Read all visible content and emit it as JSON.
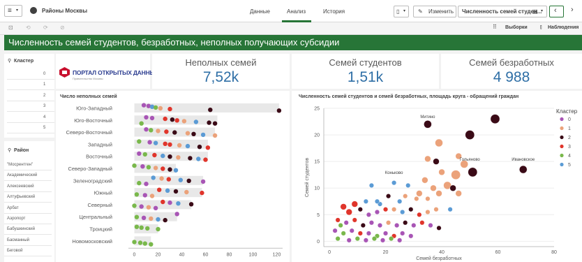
{
  "header": {
    "app_title": "Районы Москвы",
    "tabs": [
      "Данные",
      "Анализ",
      "История"
    ],
    "active_tab": 1,
    "edit_label": "Изменить",
    "sheet_title": "Численность семей студен...",
    "selections_label": "Выборки",
    "observations_label": "Наблюдения"
  },
  "banner": {
    "text": "Численность семей студентов, безработных, неполных получающих субсидии"
  },
  "filters": {
    "cluster": {
      "title": "Кластер",
      "items": [
        "0",
        "1",
        "2",
        "3",
        "4",
        "5"
      ]
    },
    "district": {
      "title": "Район",
      "items": [
        "\"Мосрентген\"",
        "Академический",
        "Алексеевский",
        "Алтуфьевский",
        "Арбат",
        "Аэропорт",
        "Бабушкинский",
        "Басманный",
        "Беговой"
      ]
    }
  },
  "logo": {
    "title": "ПОРТАЛ ОТКРЫТЫХ ДАННЫХ",
    "subtitle": "Правительство Москвы"
  },
  "kpis": [
    {
      "title": "Неполных семей",
      "value": "7,52k"
    },
    {
      "title": "Семей студентов",
      "value": "1,51k"
    },
    {
      "title": "Семей безработных",
      "value": "4 988"
    }
  ],
  "colors": {
    "accent_green": "#277537",
    "kpi_blue": "#2f6fa6",
    "cluster_0": "#a855b5",
    "cluster_1": "#eba27a",
    "cluster_2": "#3a0a16",
    "cluster_3": "#e0352b",
    "cluster_4": "#79b84b",
    "cluster_5": "#5b9bd5"
  },
  "chart_data": [
    {
      "type": "scatter",
      "title": "Число неполных семей",
      "categories": [
        "Юго-Западный",
        "Юго-Восточный",
        "Северо-Восточный",
        "Западный",
        "Восточный",
        "Северо-Западный",
        "Зеленоградский",
        "Южный",
        "Северный",
        "Центральный",
        "Троицкий",
        "Новомосковский"
      ],
      "range_max": [
        122,
        70,
        68,
        62,
        62,
        35,
        58,
        57,
        48,
        36,
        20,
        14
      ],
      "xlim": [
        -5,
        125
      ],
      "xticks": [
        0,
        20,
        40,
        60,
        80,
        100,
        120
      ],
      "points": [
        {
          "c": 0,
          "x": 8,
          "k": 0
        },
        {
          "c": 0,
          "x": 12,
          "k": 0
        },
        {
          "c": 5,
          "x": 15,
          "k": 0
        },
        {
          "c": 4,
          "x": 18,
          "k": 0
        },
        {
          "c": 1,
          "x": 22,
          "k": 0
        },
        {
          "c": 3,
          "x": 30,
          "k": 0
        },
        {
          "c": 2,
          "x": 64,
          "k": 0
        },
        {
          "c": 2,
          "x": 122,
          "k": 0
        },
        {
          "c": 4,
          "x": 6,
          "k": 1
        },
        {
          "c": 0,
          "x": 10,
          "k": 1
        },
        {
          "c": 0,
          "x": 15,
          "k": 1
        },
        {
          "c": 3,
          "x": 26,
          "k": 1
        },
        {
          "c": 2,
          "x": 32,
          "k": 1
        },
        {
          "c": 3,
          "x": 36,
          "k": 1
        },
        {
          "c": 1,
          "x": 42,
          "k": 1
        },
        {
          "c": 5,
          "x": 52,
          "k": 1
        },
        {
          "c": 2,
          "x": 63,
          "k": 1
        },
        {
          "c": 2,
          "x": 68,
          "k": 1
        },
        {
          "c": 0,
          "x": 10,
          "k": 2
        },
        {
          "c": 4,
          "x": 14,
          "k": 2
        },
        {
          "c": 1,
          "x": 20,
          "k": 2
        },
        {
          "c": 3,
          "x": 27,
          "k": 2
        },
        {
          "c": 2,
          "x": 34,
          "k": 2
        },
        {
          "c": 1,
          "x": 45,
          "k": 2
        },
        {
          "c": 2,
          "x": 50,
          "k": 2
        },
        {
          "c": 5,
          "x": 58,
          "k": 2
        },
        {
          "c": 1,
          "x": 68,
          "k": 2
        },
        {
          "c": 4,
          "x": 4,
          "k": 3
        },
        {
          "c": 0,
          "x": 13,
          "k": 3
        },
        {
          "c": 5,
          "x": 18,
          "k": 3
        },
        {
          "c": 3,
          "x": 26,
          "k": 3
        },
        {
          "c": 3,
          "x": 30,
          "k": 3
        },
        {
          "c": 1,
          "x": 38,
          "k": 3
        },
        {
          "c": 5,
          "x": 45,
          "k": 3
        },
        {
          "c": 2,
          "x": 55,
          "k": 3
        },
        {
          "c": 3,
          "x": 62,
          "k": 3
        },
        {
          "c": 0,
          "x": 4,
          "k": 4
        },
        {
          "c": 4,
          "x": 9,
          "k": 4
        },
        {
          "c": 3,
          "x": 17,
          "k": 4
        },
        {
          "c": 5,
          "x": 24,
          "k": 4
        },
        {
          "c": 2,
          "x": 30,
          "k": 4
        },
        {
          "c": 1,
          "x": 37,
          "k": 4
        },
        {
          "c": 2,
          "x": 47,
          "k": 4
        },
        {
          "c": 5,
          "x": 54,
          "k": 4
        },
        {
          "c": 3,
          "x": 60,
          "k": 4
        },
        {
          "c": 4,
          "x": 0,
          "k": 5
        },
        {
          "c": 0,
          "x": 7,
          "k": 5
        },
        {
          "c": 4,
          "x": 12,
          "k": 5
        },
        {
          "c": 1,
          "x": 18,
          "k": 5
        },
        {
          "c": 3,
          "x": 24,
          "k": 5
        },
        {
          "c": 2,
          "x": 30,
          "k": 5
        },
        {
          "c": 5,
          "x": 35,
          "k": 5
        },
        {
          "c": 4,
          "x": 4,
          "k": 6
        },
        {
          "c": 0,
          "x": 10,
          "k": 6
        },
        {
          "c": 5,
          "x": 16,
          "k": 6
        },
        {
          "c": 1,
          "x": 23,
          "k": 6
        },
        {
          "c": 3,
          "x": 29,
          "k": 6
        },
        {
          "c": 5,
          "x": 39,
          "k": 6
        },
        {
          "c": 2,
          "x": 46,
          "k": 6
        },
        {
          "c": 0,
          "x": 58,
          "k": 6
        },
        {
          "c": 4,
          "x": 2,
          "k": 7
        },
        {
          "c": 0,
          "x": 9,
          "k": 7
        },
        {
          "c": 1,
          "x": 15,
          "k": 7
        },
        {
          "c": 3,
          "x": 21,
          "k": 7
        },
        {
          "c": 5,
          "x": 28,
          "k": 7
        },
        {
          "c": 2,
          "x": 35,
          "k": 7
        },
        {
          "c": 1,
          "x": 44,
          "k": 7
        },
        {
          "c": 3,
          "x": 57,
          "k": 7
        },
        {
          "c": 4,
          "x": 0,
          "k": 8
        },
        {
          "c": 0,
          "x": 6,
          "k": 8
        },
        {
          "c": 1,
          "x": 12,
          "k": 8
        },
        {
          "c": 0,
          "x": 18,
          "k": 8
        },
        {
          "c": 3,
          "x": 24,
          "k": 8
        },
        {
          "c": 0,
          "x": 30,
          "k": 8
        },
        {
          "c": 5,
          "x": 37,
          "k": 8
        },
        {
          "c": 2,
          "x": 48,
          "k": 8
        },
        {
          "c": 4,
          "x": 2,
          "k": 9
        },
        {
          "c": 0,
          "x": 8,
          "k": 9
        },
        {
          "c": 1,
          "x": 14,
          "k": 9
        },
        {
          "c": 5,
          "x": 20,
          "k": 9
        },
        {
          "c": 2,
          "x": 26,
          "k": 9
        },
        {
          "c": 0,
          "x": 36,
          "k": 9
        },
        {
          "c": 4,
          "x": 2,
          "k": 10
        },
        {
          "c": 4,
          "x": 6,
          "k": 10
        },
        {
          "c": 4,
          "x": 11,
          "k": 10
        },
        {
          "c": 4,
          "x": 20,
          "k": 10
        },
        {
          "c": 4,
          "x": 0,
          "k": 11
        },
        {
          "c": 4,
          "x": 5,
          "k": 11
        },
        {
          "c": 4,
          "x": 9,
          "k": 11
        },
        {
          "c": 4,
          "x": 14,
          "k": 11
        }
      ]
    },
    {
      "type": "scatter",
      "title": "Численность семей студентов и семей безработных, площадь круга - обращений граждан",
      "xlabel": "Семей безработных",
      "ylabel": "Семей студентов",
      "xlim": [
        -2,
        80
      ],
      "ylim": [
        -1,
        25
      ],
      "xticks": [
        0,
        20,
        40,
        60,
        80
      ],
      "yticks": [
        0,
        5,
        10,
        15,
        20,
        25
      ],
      "legend_title": "Кластер",
      "legend": [
        "0",
        "1",
        "2",
        "3",
        "4",
        "5"
      ],
      "annotations": [
        {
          "text": "Митино",
          "x": 35,
          "y": 22
        },
        {
          "text": "Гольяново",
          "x": 50,
          "y": 14
        },
        {
          "text": "Ивановское",
          "x": 69,
          "y": 14
        },
        {
          "text": "Коньково",
          "x": 23,
          "y": 11.5
        }
      ],
      "points": [
        {
          "x": 35,
          "y": 22,
          "c": 2,
          "s": 5
        },
        {
          "x": 59,
          "y": 23,
          "c": 2,
          "s": 6
        },
        {
          "x": 50,
          "y": 20,
          "c": 2,
          "s": 6
        },
        {
          "x": 39,
          "y": 18.5,
          "c": 1,
          "s": 5
        },
        {
          "x": 51,
          "y": 13,
          "c": 2,
          "s": 6
        },
        {
          "x": 69,
          "y": 13.5,
          "c": 2,
          "s": 5
        },
        {
          "x": 45,
          "y": 12.5,
          "c": 1,
          "s": 6
        },
        {
          "x": 48,
          "y": 14.5,
          "c": 1,
          "s": 5
        },
        {
          "x": 35,
          "y": 15.5,
          "c": 1,
          "s": 4
        },
        {
          "x": 38,
          "y": 15,
          "c": 2,
          "s": 4
        },
        {
          "x": 46,
          "y": 16,
          "c": 1,
          "s": 4
        },
        {
          "x": 40,
          "y": 13,
          "c": 1,
          "s": 4
        },
        {
          "x": 34,
          "y": 11.5,
          "c": 1,
          "s": 4
        },
        {
          "x": 42,
          "y": 10.5,
          "c": 1,
          "s": 5
        },
        {
          "x": 37,
          "y": 10,
          "c": 1,
          "s": 4
        },
        {
          "x": 44,
          "y": 10,
          "c": 2,
          "s": 4
        },
        {
          "x": 32,
          "y": 9,
          "c": 1,
          "s": 4
        },
        {
          "x": 39,
          "y": 9,
          "c": 1,
          "s": 4
        },
        {
          "x": 46,
          "y": 9,
          "c": 1,
          "s": 4
        },
        {
          "x": 28,
          "y": 10.5,
          "c": 5,
          "s": 3
        },
        {
          "x": 15,
          "y": 10.5,
          "c": 5,
          "s": 3
        },
        {
          "x": 23,
          "y": 11,
          "c": 5,
          "s": 3
        },
        {
          "x": 27,
          "y": 8.5,
          "c": 1,
          "s": 3
        },
        {
          "x": 31,
          "y": 8,
          "c": 1,
          "s": 3
        },
        {
          "x": 35,
          "y": 8,
          "c": 1,
          "s": 3
        },
        {
          "x": 25,
          "y": 7.5,
          "c": 5,
          "s": 3
        },
        {
          "x": 21,
          "y": 8.5,
          "c": 2,
          "s": 3
        },
        {
          "x": 18,
          "y": 7,
          "c": 5,
          "s": 3
        },
        {
          "x": 13,
          "y": 7.5,
          "c": 5,
          "s": 3
        },
        {
          "x": 9,
          "y": 7,
          "c": 3,
          "s": 4
        },
        {
          "x": 5,
          "y": 6.5,
          "c": 3,
          "s": 4
        },
        {
          "x": 7,
          "y": 5.5,
          "c": 3,
          "s": 4
        },
        {
          "x": 11,
          "y": 6,
          "c": 2,
          "s": 3
        },
        {
          "x": 14,
          "y": 5,
          "c": 0,
          "s": 3
        },
        {
          "x": 17,
          "y": 5.5,
          "c": 0,
          "s": 3
        },
        {
          "x": 20,
          "y": 6,
          "c": 3,
          "s": 3
        },
        {
          "x": 23,
          "y": 6,
          "c": 1,
          "s": 3
        },
        {
          "x": 26,
          "y": 5.5,
          "c": 5,
          "s": 3
        },
        {
          "x": 29,
          "y": 6,
          "c": 2,
          "s": 3
        },
        {
          "x": 32,
          "y": 5,
          "c": 3,
          "s": 3
        },
        {
          "x": 35,
          "y": 5.5,
          "c": 1,
          "s": 3
        },
        {
          "x": 38,
          "y": 6,
          "c": 1,
          "s": 3
        },
        {
          "x": 43,
          "y": 6,
          "c": 5,
          "s": 3
        },
        {
          "x": 3,
          "y": 4,
          "c": 3,
          "s": 3
        },
        {
          "x": 6,
          "y": 3.5,
          "c": 0,
          "s": 3
        },
        {
          "x": 9,
          "y": 4,
          "c": 3,
          "s": 3
        },
        {
          "x": 12,
          "y": 3,
          "c": 2,
          "s": 3
        },
        {
          "x": 15,
          "y": 3.5,
          "c": 0,
          "s": 3
        },
        {
          "x": 18,
          "y": 3,
          "c": 0,
          "s": 3
        },
        {
          "x": 21,
          "y": 3.5,
          "c": 1,
          "s": 3
        },
        {
          "x": 24,
          "y": 3,
          "c": 0,
          "s": 3
        },
        {
          "x": 27,
          "y": 3.5,
          "c": 2,
          "s": 3
        },
        {
          "x": 30,
          "y": 3,
          "c": 0,
          "s": 3
        },
        {
          "x": 33,
          "y": 3.5,
          "c": 3,
          "s": 3
        },
        {
          "x": 36,
          "y": 3,
          "c": 0,
          "s": 3
        },
        {
          "x": 39,
          "y": 2.5,
          "c": 2,
          "s": 3
        },
        {
          "x": 2,
          "y": 2,
          "c": 0,
          "s": 3
        },
        {
          "x": 5,
          "y": 1.5,
          "c": 4,
          "s": 3
        },
        {
          "x": 8,
          "y": 2,
          "c": 0,
          "s": 3
        },
        {
          "x": 11,
          "y": 1.5,
          "c": 3,
          "s": 3
        },
        {
          "x": 14,
          "y": 1.5,
          "c": 0,
          "s": 3
        },
        {
          "x": 17,
          "y": 1,
          "c": 4,
          "s": 3
        },
        {
          "x": 20,
          "y": 1.5,
          "c": 0,
          "s": 3
        },
        {
          "x": 23,
          "y": 1,
          "c": 3,
          "s": 3
        },
        {
          "x": 26,
          "y": 1.5,
          "c": 0,
          "s": 3
        },
        {
          "x": 29,
          "y": 1,
          "c": 0,
          "s": 3
        },
        {
          "x": 3,
          "y": 0.5,
          "c": 4,
          "s": 3
        },
        {
          "x": 7,
          "y": 0.2,
          "c": 0,
          "s": 3
        },
        {
          "x": 10,
          "y": 0.5,
          "c": 4,
          "s": 3
        },
        {
          "x": 13,
          "y": 0.2,
          "c": 0,
          "s": 3
        },
        {
          "x": 16,
          "y": 0.5,
          "c": 4,
          "s": 3
        },
        {
          "x": 19,
          "y": 0.2,
          "c": 0,
          "s": 3
        },
        {
          "x": 22,
          "y": 0.5,
          "c": 4,
          "s": 3
        },
        {
          "x": 25,
          "y": 0.2,
          "c": 0,
          "s": 3
        },
        {
          "x": 4,
          "y": 3,
          "c": 4,
          "s": 3
        },
        {
          "x": 17,
          "y": 7.5,
          "c": 5,
          "s": 3
        }
      ]
    }
  ]
}
